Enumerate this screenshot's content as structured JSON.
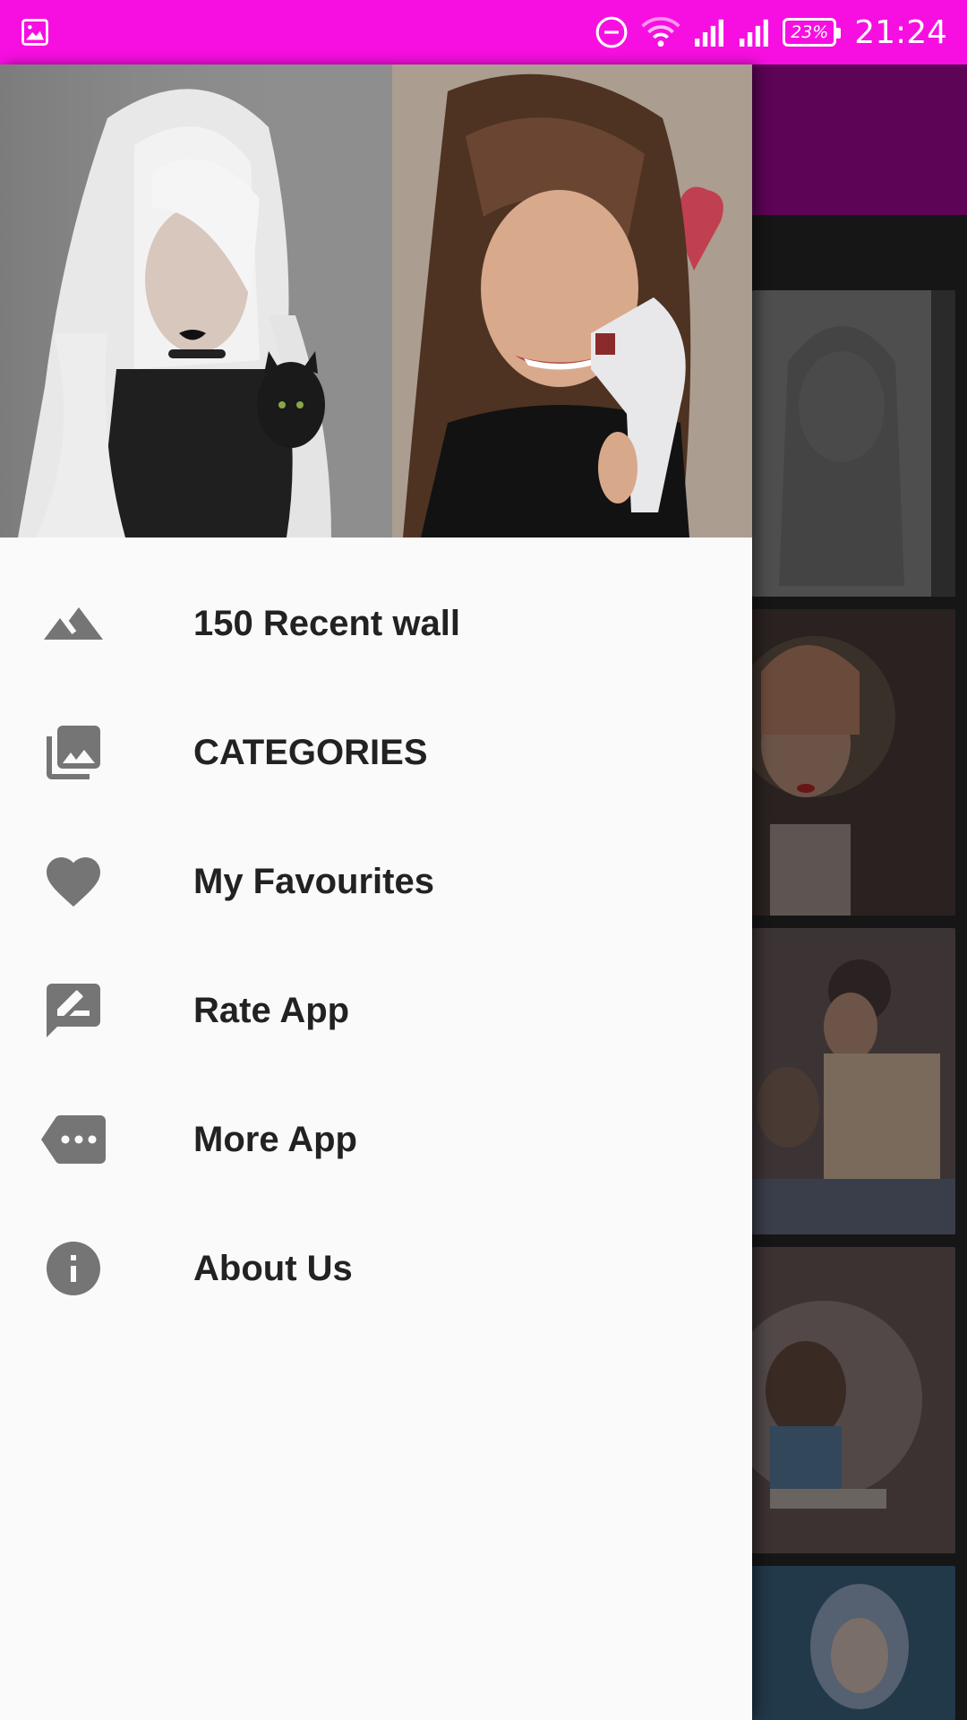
{
  "status_bar": {
    "battery_percent": "23%",
    "time": "21:24",
    "icons": [
      "image-notification-icon",
      "do-not-disturb-icon",
      "wifi-icon",
      "signal-icon",
      "signal-icon-2",
      "battery-icon"
    ]
  },
  "drawer": {
    "header_images": [
      "wallpaper-girl-white-hair",
      "wallpaper-girl-brown-hair"
    ],
    "menu": [
      {
        "label": "150 Recent wall",
        "icon": "landscape-icon"
      },
      {
        "label": "CATEGORIES",
        "icon": "photo-library-icon"
      },
      {
        "label": "My Favourites",
        "icon": "heart-icon"
      },
      {
        "label": "Rate App",
        "icon": "rate-review-icon"
      },
      {
        "label": "More App",
        "icon": "more-label-icon"
      },
      {
        "label": "About Us",
        "icon": "info-icon"
      }
    ]
  },
  "colors": {
    "status_bar": "#f70fe1",
    "app_bar": "#5d0456",
    "drawer_bg": "#fafafa",
    "icon_gray": "#757575",
    "text": "#222222"
  }
}
